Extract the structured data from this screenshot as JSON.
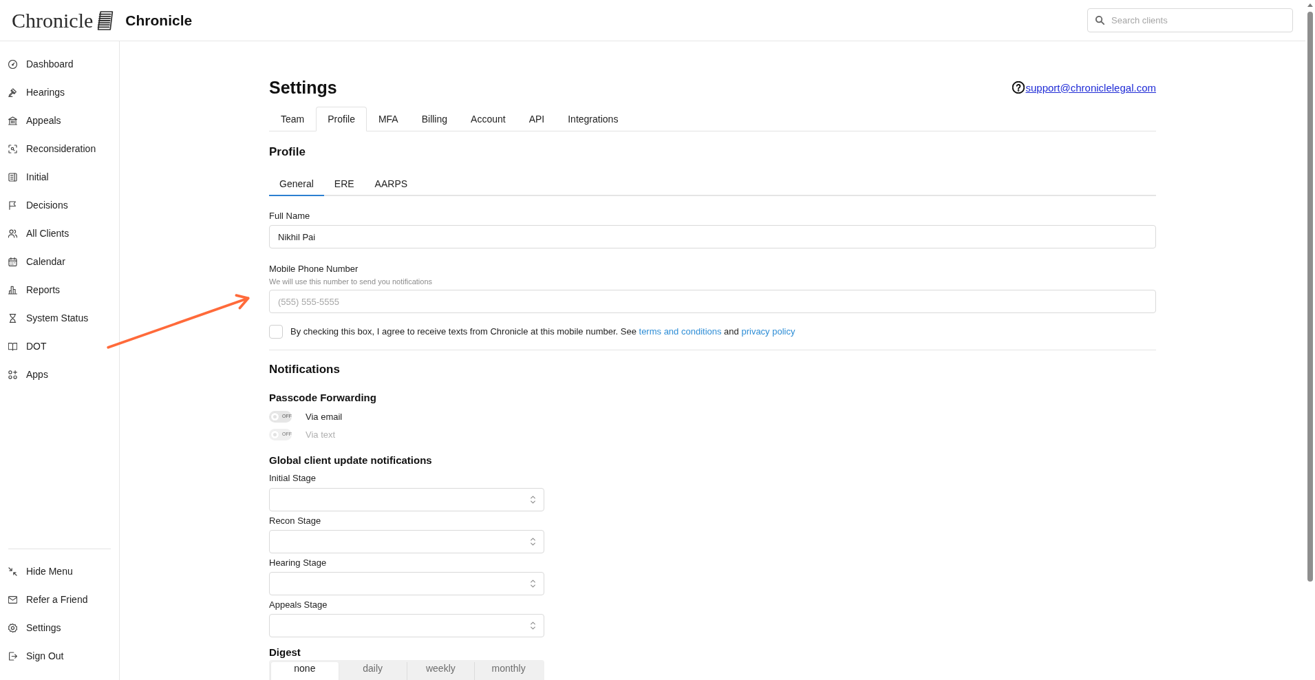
{
  "header": {
    "logo": "Chronicle",
    "app_name": "Chronicle",
    "search": {
      "placeholder": "Search clients"
    }
  },
  "sidebar": {
    "items": [
      {
        "label": "Dashboard"
      },
      {
        "label": "Hearings"
      },
      {
        "label": "Appeals"
      },
      {
        "label": "Reconsideration"
      },
      {
        "label": "Initial"
      },
      {
        "label": "Decisions"
      },
      {
        "label": "All Clients"
      },
      {
        "label": "Calendar"
      },
      {
        "label": "Reports"
      },
      {
        "label": "System Status"
      },
      {
        "label": "DOT"
      },
      {
        "label": "Apps"
      }
    ],
    "footer_items": [
      {
        "label": "Hide Menu"
      },
      {
        "label": "Refer a Friend"
      },
      {
        "label": "Settings"
      },
      {
        "label": "Sign Out"
      }
    ]
  },
  "settings": {
    "title": "Settings",
    "support_email": "support@chroniclelegal.com",
    "tabs": [
      {
        "label": "Team",
        "selected": false
      },
      {
        "label": "Profile",
        "selected": true
      },
      {
        "label": "MFA",
        "selected": false
      },
      {
        "label": "Billing",
        "selected": false
      },
      {
        "label": "Account",
        "selected": false
      },
      {
        "label": "API",
        "selected": false
      },
      {
        "label": "Integrations",
        "selected": false
      }
    ],
    "profile": {
      "title": "Profile",
      "subtabs": [
        {
          "label": "General",
          "selected": true
        },
        {
          "label": "ERE",
          "selected": false
        },
        {
          "label": "AARPS",
          "selected": false
        }
      ],
      "full_name": {
        "label": "Full Name",
        "value": "Nikhil Pai"
      },
      "mobile_phone": {
        "label": "Mobile Phone Number",
        "hint": "We will use this number to send you notifications",
        "placeholder": "(555) 555-5555"
      },
      "sms_consent": {
        "checked": false,
        "parts": [
          {
            "kind": "text",
            "text": "By checking this box, I agree to receive texts from Chronicle at this mobile number. See"
          },
          {
            "kind": "link",
            "text": "terms and conditions"
          },
          {
            "kind": "text",
            "text": "and"
          },
          {
            "kind": "link",
            "text": "privacy policy"
          }
        ]
      }
    },
    "notifications": {
      "title": "Notifications",
      "passcode_forwarding": {
        "title": "Passcode Forwarding",
        "toggles": [
          {
            "label": "Via email",
            "on": false,
            "disabled": false,
            "state_text": "OFF"
          },
          {
            "label": "Via text",
            "on": false,
            "disabled": true,
            "state_text": "OFF"
          }
        ]
      },
      "global_updates": {
        "title": "Global client update notifications",
        "selects": [
          {
            "label": "Initial Stage"
          },
          {
            "label": "Recon Stage"
          },
          {
            "label": "Hearing Stage"
          },
          {
            "label": "Appeals Stage"
          }
        ]
      },
      "digest": {
        "title": "Digest",
        "options": [
          {
            "label": "none",
            "selected": true
          },
          {
            "label": "daily",
            "selected": false
          },
          {
            "label": "weekly",
            "selected": false
          },
          {
            "label": "monthly",
            "selected": false
          }
        ]
      }
    }
  }
}
